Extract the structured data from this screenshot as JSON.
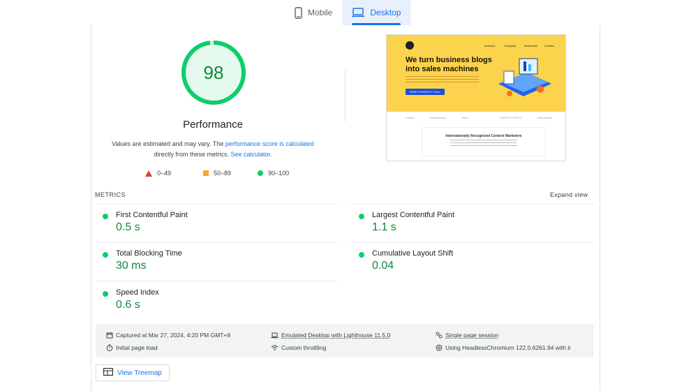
{
  "tabs": [
    {
      "label": "Mobile",
      "icon": "mobile-icon",
      "active": false
    },
    {
      "label": "Desktop",
      "icon": "desktop-icon",
      "active": true
    }
  ],
  "performance": {
    "score": "98",
    "score_value": 98,
    "title": "Performance",
    "desc_prefix": "Values are estimated and may vary. The ",
    "desc_link1": "performance score is calculated",
    "desc_middle": " directly from these metrics. ",
    "desc_link2": "See calculator."
  },
  "legend": [
    {
      "shape": "triangle",
      "label": "0–49",
      "color": "#e53935"
    },
    {
      "shape": "square",
      "label": "50–89",
      "color": "#f9a825"
    },
    {
      "shape": "circle",
      "label": "90–100",
      "color": "#0cce6b"
    }
  ],
  "screenshot": {
    "nav": [
      "Services",
      "Company",
      "Resources",
      "Contact"
    ],
    "headline_line1": "We turn business blogs",
    "headline_line2": "into sales machines",
    "cta": "FREE STRATEGY CALL",
    "logos": [
      "Forbes",
      "Entrepreneur",
      "Buzz",
      "",
      "SHOPIFY/STATS",
      "Venturebeat"
    ],
    "box_title": "Internationally Recognized Content Marketers"
  },
  "metrics": {
    "section_label": "METRICS",
    "expand_label": "Expand view",
    "items": [
      {
        "name": "First Contentful Paint",
        "value": "0.5 s"
      },
      {
        "name": "Largest Contentful Paint",
        "value": "1.1 s"
      },
      {
        "name": "Total Blocking Time",
        "value": "30 ms"
      },
      {
        "name": "Cumulative Layout Shift",
        "value": "0.04"
      },
      {
        "name": "Speed Index",
        "value": "0.6 s"
      }
    ]
  },
  "info": {
    "captured": "Captured at Mar 27, 2024, 4:20 PM GMT+8",
    "initial_load": "Initial page load",
    "emulated": "Emulated Desktop with Lighthouse 11.5.0",
    "throttling": "Custom throttling",
    "session": "Single page session",
    "browser": "Using HeadlessChromium 122.0.6261.94 with lr"
  },
  "treemap_label": "View Treemap",
  "colors": {
    "pass": "#0cce6b",
    "pass_text": "#0d8a3c",
    "accent": "#1a73e8"
  }
}
